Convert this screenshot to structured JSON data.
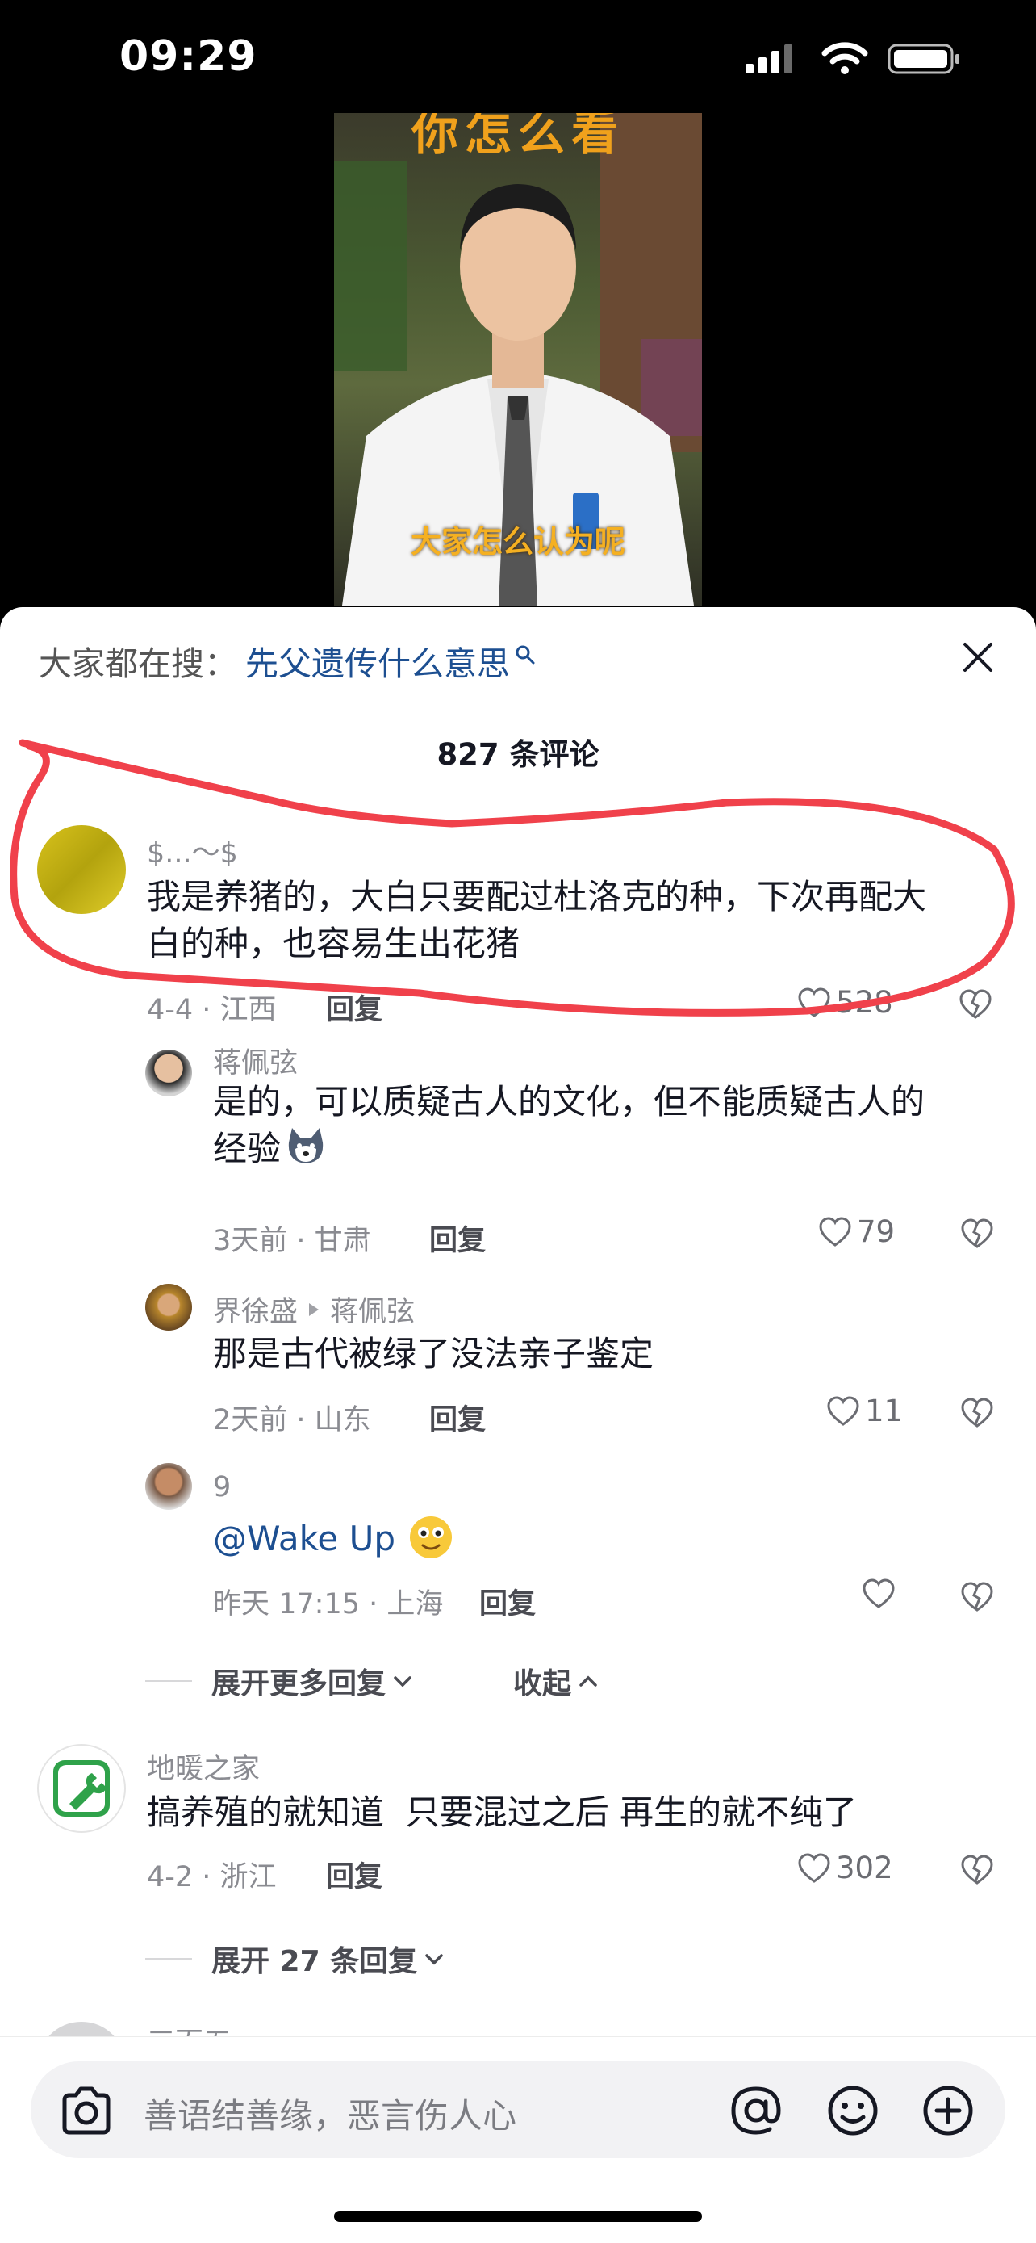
{
  "status_bar": {
    "time": "09:29"
  },
  "video": {
    "top_caption": "你怎么看",
    "bottom_caption": "大家怎么认为呢"
  },
  "search_bar": {
    "label": "大家都在搜：",
    "term": "先父遗传什么意思"
  },
  "comments_header": {
    "count_text": "827 条评论"
  },
  "comments": [
    {
      "author": "$...～$",
      "text_lines": [
        "我是养猪的，大白只要配过杜洛克的种，下次再配大",
        "白的种，也容易生出花猪"
      ],
      "meta": "4-4 · 江西",
      "reply_label": "回复",
      "likes": "528"
    },
    {
      "author": "蒋佩弦",
      "text_lines": [
        "是的，可以质疑古人的文化，但不能质疑古人的",
        "经验"
      ],
      "meta": "3天前 · 甘肃",
      "reply_label": "回复",
      "likes": "79"
    },
    {
      "author": "界徐盛",
      "reply_to": "蒋佩弦",
      "text_lines": [
        "那是古代被绿了没法亲子鉴定"
      ],
      "meta": "2天前 · 山东",
      "reply_label": "回复",
      "likes": "11"
    },
    {
      "author": "9",
      "text_lines": [
        "@Wake Up"
      ],
      "meta": "昨天 17:15 · 上海",
      "reply_label": "回复",
      "likes": ""
    },
    {
      "author": "地暖之家",
      "text_lines": [
        "搞养殖的就知道  只要混过之后 再生的就不纯了"
      ],
      "meta": "4-2 · 浙江",
      "reply_label": "回复",
      "likes": "302"
    }
  ],
  "thread_controls": {
    "expand_more": "展开更多回复",
    "collapse": "收起",
    "expand_count": "展开 27 条回复"
  },
  "partial_author": "三百五",
  "input_bar": {
    "placeholder": "善语结善缘，恶言伤人心"
  },
  "colors": {
    "link_blue": "#1d4f91",
    "annotation_red": "#f0414b"
  }
}
